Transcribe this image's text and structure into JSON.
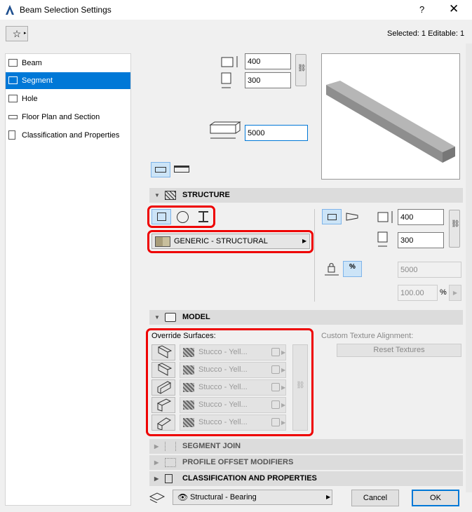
{
  "window": {
    "title": "Beam Selection Settings",
    "help": "?",
    "close": "✕"
  },
  "header": {
    "selection_info": "Selected: 1 Editable: 1"
  },
  "sidebar": {
    "items": [
      {
        "label": "Beam"
      },
      {
        "label": "Segment"
      },
      {
        "label": "Hole"
      },
      {
        "label": "Floor Plan and Section"
      },
      {
        "label": "Classification and Properties"
      }
    ]
  },
  "geometry": {
    "height": "400",
    "width": "300",
    "length": "5000"
  },
  "sections": {
    "structure": "STRUCTURE",
    "model": "MODEL",
    "segment_join": "SEGMENT JOIN",
    "profile_offset": "PROFILE OFFSET MODIFIERS",
    "classification": "CLASSIFICATION AND PROPERTIES"
  },
  "structure": {
    "building_material": "GENERIC - STRUCTURAL",
    "height": "400",
    "width": "300",
    "end_value": "5000",
    "percent_value": "100.00",
    "percent_sign": "%"
  },
  "model": {
    "override_label": "Override Surfaces:",
    "texture_label": "Custom Texture Alignment:",
    "reset_textures": "Reset Textures",
    "surfaces": [
      {
        "label": "Stucco - Yell..."
      },
      {
        "label": "Stucco - Yell..."
      },
      {
        "label": "Stucco - Yell..."
      },
      {
        "label": "Stucco - Yell..."
      },
      {
        "label": "Stucco - Yell..."
      }
    ]
  },
  "footer": {
    "layer": "Structural - Bearing",
    "cancel": "Cancel",
    "ok": "OK"
  }
}
